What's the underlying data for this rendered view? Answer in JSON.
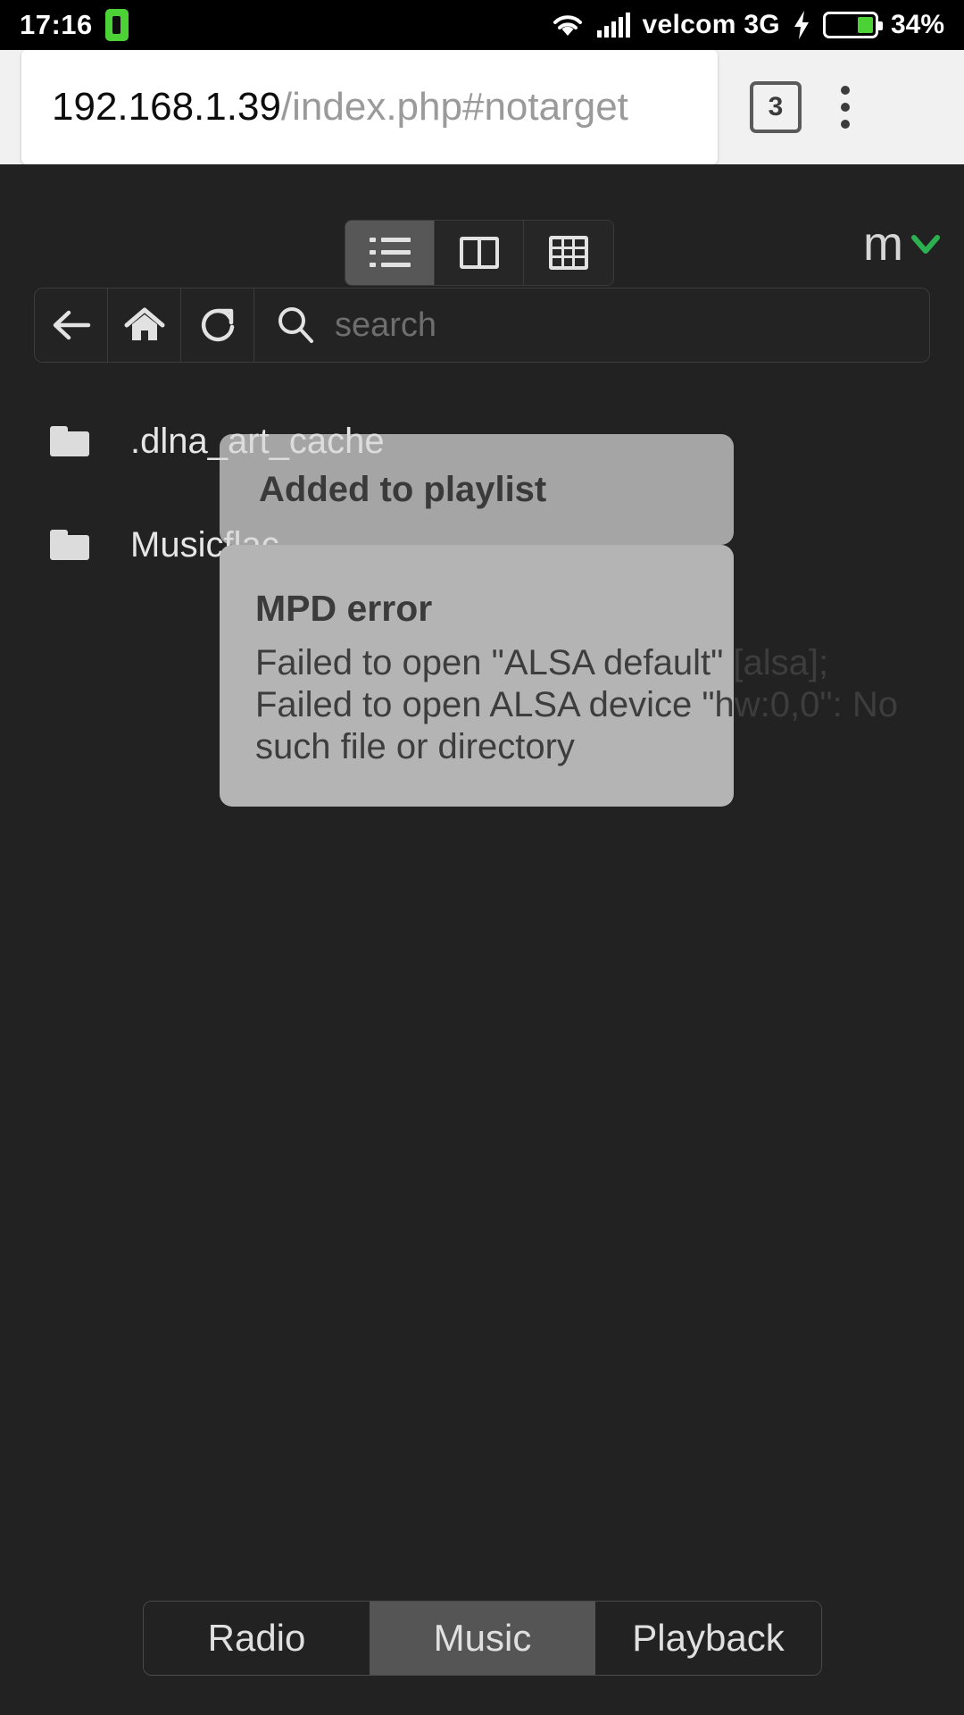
{
  "statusbar": {
    "clock": "17:16",
    "battery_icon": "battery-chip-icon",
    "wifi_icon": "wifi-icon",
    "signal_icon": "signal-bars-icon",
    "carrier": "velcom 3G",
    "charging_icon": "lightning-bolt-icon",
    "battery_percent": "34%"
  },
  "browser": {
    "url_host": "192.168.1.39",
    "url_path": "/index.php#notarget",
    "url_full": "192.168.1.39/index.php#notarget",
    "tab_count": "3",
    "menu_icon": "kebab-menu-icon"
  },
  "app": {
    "view_modes": [
      {
        "name": "list-view",
        "icon": "list-icon",
        "active": true
      },
      {
        "name": "columns-view",
        "icon": "columns-icon",
        "active": false
      },
      {
        "name": "grid-view",
        "icon": "grid-icon",
        "active": false
      }
    ],
    "menu_label": "m",
    "menu_chevron_icon": "chevron-down-icon",
    "menu_chevron_color": "#2bb14f",
    "toolbar": [
      {
        "name": "back-button",
        "icon": "arrow-left-icon"
      },
      {
        "name": "home-button",
        "icon": "home-icon"
      },
      {
        "name": "refresh-button",
        "icon": "refresh-icon"
      }
    ],
    "search": {
      "icon": "search-icon",
      "placeholder": "search",
      "value": ""
    },
    "files": [
      {
        "icon": "folder-icon",
        "name": ".dlna_art_cache"
      },
      {
        "icon": "folder-icon",
        "name": "Musicflac"
      }
    ],
    "toasts": [
      {
        "id": "added-to-playlist",
        "title": "Added to playlist",
        "lines": []
      },
      {
        "id": "mpd-error",
        "title": "MPD error",
        "lines": [
          "Failed to open \"ALSA default\" [alsa];",
          "Failed to open ALSA device \"hw:0,0\": No",
          "such file or directory"
        ]
      }
    ],
    "bottom_tabs": [
      {
        "label": "Radio",
        "active": false
      },
      {
        "label": "Music",
        "active": true
      },
      {
        "label": "Playback",
        "active": false
      }
    ]
  },
  "colors": {
    "app_background": "#222222",
    "accent_green": "#2bb14f",
    "toast_background": "#b4b4b4",
    "active_segment": "#575757",
    "status_battery_green": "#4cd137"
  }
}
